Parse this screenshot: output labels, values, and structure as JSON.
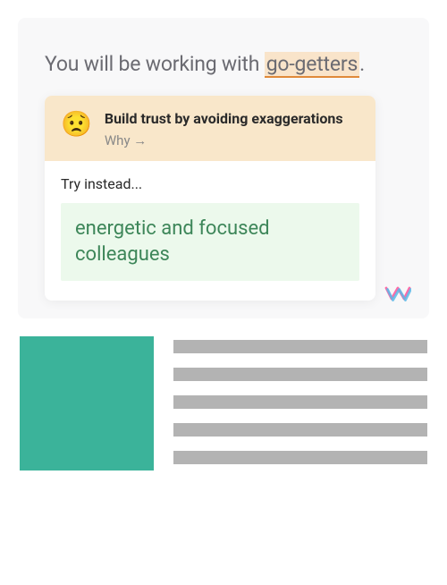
{
  "sentence": {
    "prefix": "You will be working with ",
    "highlighted": "go-getters",
    "suffix": "."
  },
  "suggestion": {
    "emoji": "😟",
    "title": "Build trust by avoiding exaggerations",
    "why_label": "Why →",
    "try_label": "Try instead...",
    "replacement": "energetic and focused colleagues"
  },
  "colors": {
    "highlight_bg": "#f9e4ca",
    "highlight_underline": "#e08a3a",
    "suggestion_header_bg": "#f9e7ca",
    "replacement_bg": "#ecf9ec",
    "replacement_text": "#3d8659",
    "placeholder_image": "#3bb39a"
  }
}
